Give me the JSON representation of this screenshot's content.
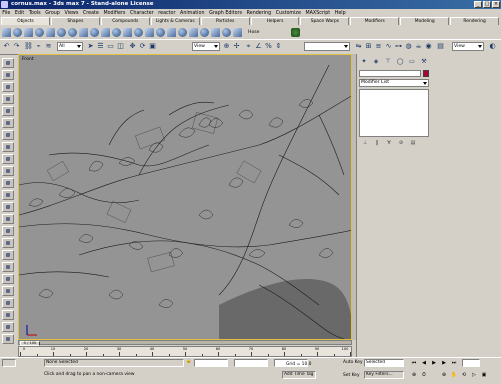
{
  "window": {
    "title": "cornus.max - 3ds max 7 - Stand-alone License"
  },
  "menu": [
    "File",
    "Edit",
    "Tools",
    "Group",
    "Views",
    "Create",
    "Modifiers",
    "Character",
    "reactor",
    "Animation",
    "Graph Editors",
    "Rendering",
    "Customize",
    "MAXScript",
    "Help"
  ],
  "tabs": [
    "Objects",
    "Shapes",
    "Compounds",
    "Lights & Cameras",
    "Particles",
    "Helpers",
    "Space Warps",
    "Modifiers",
    "Modeling",
    "Rendering"
  ],
  "active_tab": "Objects",
  "command_panel": {
    "plant_label": "Hose"
  },
  "toolbar": {
    "selection_filter": "All",
    "ref_coord": "View",
    "named_sel": "",
    "render_view": "View"
  },
  "viewport": {
    "label": "Front",
    "border_color": "#e0c040"
  },
  "modifier": {
    "list_label": "Modifier List",
    "object_color": "#b0003a"
  },
  "timeline": {
    "frame_label": "0 / 100",
    "ticks": [
      "0",
      "10",
      "20",
      "30",
      "40",
      "50",
      "60",
      "70",
      "80",
      "90",
      "100"
    ]
  },
  "status": {
    "selection": "None Selected",
    "prompt": "Click and drag to pan a non-camera view",
    "grid": "Grid = 10.0",
    "add_time_tag": "Add Time Tag",
    "auto_key": "Auto Key",
    "set_key": "Set Key",
    "key_filter_value": "Selected",
    "key_filters": "Key Filters..."
  }
}
